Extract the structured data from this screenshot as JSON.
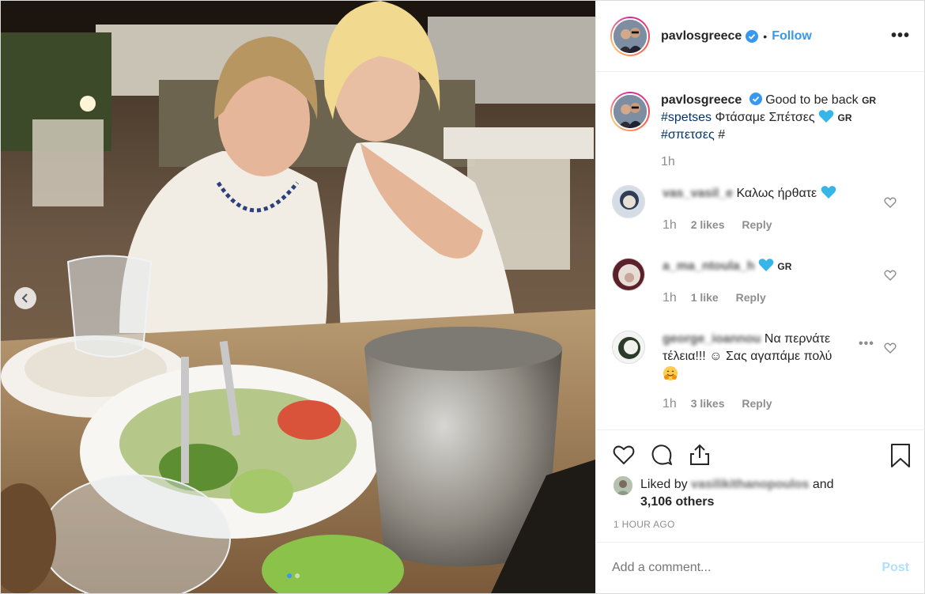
{
  "post": {
    "username": "pavlosgreece",
    "follow_label": "Follow",
    "separator": "•",
    "more_label": "•••",
    "caption": {
      "text_1": "Good to be back",
      "gr_1": "GR",
      "hashtag_1": "#spetses",
      "text_2": "Φτάσαμε Σπέτσες",
      "gr_2": "GR",
      "hashtag_2": "#σπετσες",
      "trailing": "#",
      "time": "1h"
    },
    "comments": [
      {
        "username": "vas_vasil_e",
        "visible_suffix": "_e",
        "text": "Καλως ήρθατε",
        "time": "1h",
        "likes": "2 likes",
        "reply": "Reply"
      },
      {
        "username": "a_ma_ntoula_h",
        "text": "GR",
        "time": "1h",
        "likes": "1 like",
        "reply": "Reply"
      },
      {
        "username": "george_ioannou",
        "text": "Να περνάτε τέλεια!!! ☺ Σας αγαπάμε πολύ",
        "time": "1h",
        "likes": "3 likes",
        "reply": "Reply",
        "more_label": "•••"
      }
    ],
    "likes": {
      "prefix": "Liked by",
      "blurred_user": "vasilikithanopoulos",
      "suffix": "and",
      "others": "3,106 others"
    },
    "timestamp": "1 HOUR AGO",
    "comment_input": {
      "placeholder": "Add a comment..."
    },
    "post_button": "Post"
  },
  "carousel": {
    "slide_count": 2,
    "active_index": 0
  },
  "colors": {
    "accent": "#3897f0",
    "post_disabled": "#b2dffc",
    "hashtag": "#003569",
    "muted": "#8e8e8e"
  },
  "icons": [
    "chevron-left-icon",
    "verified-badge-icon",
    "heart-icon",
    "comment-icon",
    "share-icon",
    "bookmark-icon",
    "blue-heart-emoji",
    "hugging-face-emoji"
  ]
}
